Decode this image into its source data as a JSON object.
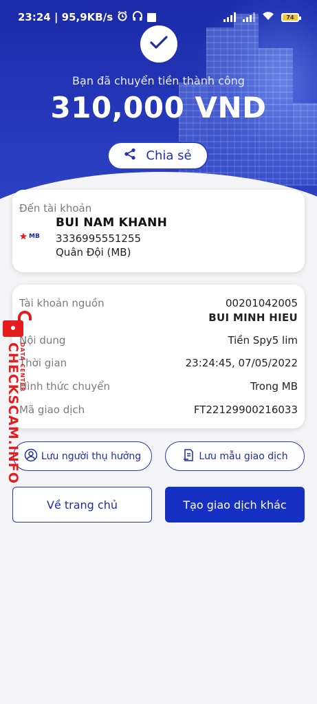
{
  "status_bar": {
    "time_info": "23:24 | 95,9KB/s",
    "battery": "74"
  },
  "hero": {
    "message": "Bạn đã chuyển tiền thành công",
    "amount": "310,000 VND",
    "share_label": "Chia sẻ"
  },
  "recipient": {
    "label": "Đến tài khoản",
    "bank_logo_text": "MB",
    "name": "BUI NAM KHANH",
    "account_number": "3336995551255",
    "bank_name": "Quân Đội (MB)"
  },
  "details": {
    "rows": [
      {
        "label": "Tài khoản nguồn",
        "value": "00201042005",
        "value2": "BUI MINH HIEU"
      },
      {
        "label": "Nội dung",
        "value": "Tiền Spy5 lim"
      },
      {
        "label": "Thời gian",
        "value": "23:24:45, 07/05/2022"
      },
      {
        "label": "Hình thức chuyển",
        "value": "Trong MB"
      },
      {
        "label": "Mã giao dịch",
        "value": "FT22129900216033"
      }
    ]
  },
  "actions": {
    "save_recipient": "Lưu người thụ hưởng",
    "save_template": "Lưu mẫu giao dịch",
    "home": "Về trang chủ",
    "new_transaction": "Tạo giao dịch khác"
  },
  "watermark": {
    "brand": "CHECKSCAM.INFO",
    "sub": "DATA CENTER"
  },
  "colors": {
    "primary": "#1730c4",
    "hero_bg": "#2536b8",
    "watermark": "#e31d1d"
  },
  "icons": [
    "check-icon",
    "share-icon",
    "user-circle-icon",
    "document-icon",
    "lock-icon",
    "wifi-icon",
    "signal-icon",
    "alarm-icon",
    "headphones-icon"
  ]
}
